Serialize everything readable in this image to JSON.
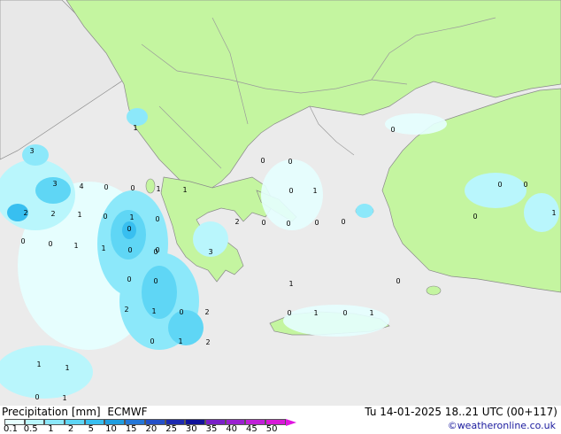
{
  "map": {
    "colors": {
      "sea": "#ebebeb",
      "land": "#c4f5a0",
      "other_land": "#e8e8e8",
      "border": "#9a9a9a",
      "coast": "#8a8a8a"
    },
    "point_labels": [
      {
        "t": "3"
      },
      {
        "t": "1"
      },
      {
        "t": "3"
      },
      {
        "t": "4"
      },
      {
        "t": "0"
      },
      {
        "t": "0"
      },
      {
        "t": "1"
      },
      {
        "t": "1"
      },
      {
        "t": "2"
      },
      {
        "t": "2"
      },
      {
        "t": "1"
      },
      {
        "t": "0"
      },
      {
        "t": "1"
      },
      {
        "t": "0"
      },
      {
        "t": "0"
      },
      {
        "t": "0"
      },
      {
        "t": "0"
      },
      {
        "t": "1"
      },
      {
        "t": "2"
      },
      {
        "t": "0"
      },
      {
        "t": "3"
      },
      {
        "t": "0"
      },
      {
        "t": "0"
      },
      {
        "t": "0"
      },
      {
        "t": "0"
      },
      {
        "t": "0"
      },
      {
        "t": "1"
      },
      {
        "t": "1"
      },
      {
        "t": "0"
      },
      {
        "t": "0"
      },
      {
        "t": "0"
      },
      {
        "t": "0"
      },
      {
        "t": "2"
      },
      {
        "t": "1"
      },
      {
        "t": "0"
      },
      {
        "t": "2"
      },
      {
        "t": "0"
      },
      {
        "t": "1"
      },
      {
        "t": "2"
      },
      {
        "t": "1"
      },
      {
        "t": "0"
      },
      {
        "t": "1"
      },
      {
        "t": "0"
      },
      {
        "t": "1"
      },
      {
        "t": "0"
      },
      {
        "t": "1"
      },
      {
        "t": "1"
      },
      {
        "t": "0"
      },
      {
        "t": "1"
      },
      {
        "t": "0"
      },
      {
        "t": "0"
      },
      {
        "t": "0"
      },
      {
        "t": "0"
      },
      {
        "t": "1"
      },
      {
        "t": "0"
      },
      {
        "t": "0"
      }
    ]
  },
  "legend": {
    "title": "Precipitation [mm]",
    "model": "ECMWF",
    "colors": [
      "#e6ffff",
      "#b9f6fc",
      "#8ce8fa",
      "#5fd6f5",
      "#38bff0",
      "#1f9ee0",
      "#2477d8",
      "#2450c8",
      "#1d2ab0",
      "#10129a",
      "#7a20c8",
      "#9a20d0",
      "#c020d8",
      "#d818d8",
      "#e015e0"
    ],
    "ticks": [
      "0.1",
      "0.5",
      "1",
      "2",
      "5",
      "10",
      "15",
      "20",
      "25",
      "30",
      "35",
      "40",
      "45",
      "50"
    ]
  },
  "date_label": "Tu 14-01-2025 18..21 UTC (00+117)",
  "credit": "©weatheronline.co.uk"
}
